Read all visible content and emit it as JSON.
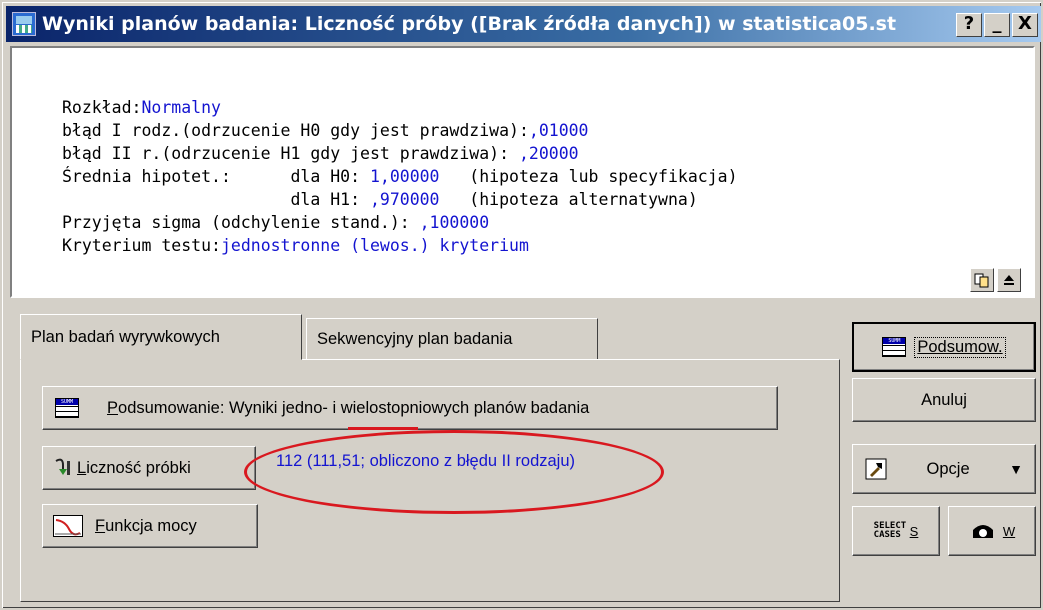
{
  "window": {
    "title": "Wyniki planów badania: Liczność próby ([Brak źródła danych]) w statistica05.st",
    "help_btn": "?",
    "min_btn": "_",
    "close_btn": "X"
  },
  "output": {
    "l1_label": "Rozkład:",
    "l1_value": "Normalny",
    "l2_label": "błąd I rodz.(odrzucenie H0 gdy jest prawdziwa):",
    "l2_value": ",01000",
    "l3_label": "błąd II r.(odrzucenie H1 gdy jest prawdziwa): ",
    "l3_value": ",20000",
    "l4_label": "Średnia hipotet.:      dla H0: ",
    "l4_value": "1,00000",
    "l4_note": "   (hipoteza lub specyfikacja)",
    "l5_label": "                       dla H1: ",
    "l5_value": ",970000",
    "l5_note": "   (hipoteza alternatywna)",
    "l6_label": "Przyjęta sigma (odchylenie stand.): ",
    "l6_value": ",100000",
    "l7_label": "Kryterium testu:",
    "l7_value": "jednostronne (lewos.) kryterium"
  },
  "tabs": {
    "active": "Plan badań wyrywkowych",
    "inactive": "Sekwencyjny plan badania"
  },
  "panel": {
    "summary_key": "P",
    "summary_rest": "odsumowanie:  Wyniki jedno- i wielostopniowych planów badania",
    "sample_key": "L",
    "sample_rest": "iczność próbki",
    "sample_result": "112 (111,51; obliczono z błędu II rodzaju)",
    "power_key": "F",
    "power_rest": "unkcja mocy"
  },
  "side": {
    "summary_label": "Podsumow.",
    "cancel_label": "Anuluj",
    "options_label": "Opcje",
    "select_cases_label": "S",
    "weight_label": "W",
    "select_cases_icon_text": "SELECT CASES",
    "summ_icon_text": "SUMM"
  },
  "colors": {
    "title_bar": "#0a246a",
    "value_text": "#1414d0",
    "annotation": "#d9181f",
    "face": "#d4d0c8"
  }
}
